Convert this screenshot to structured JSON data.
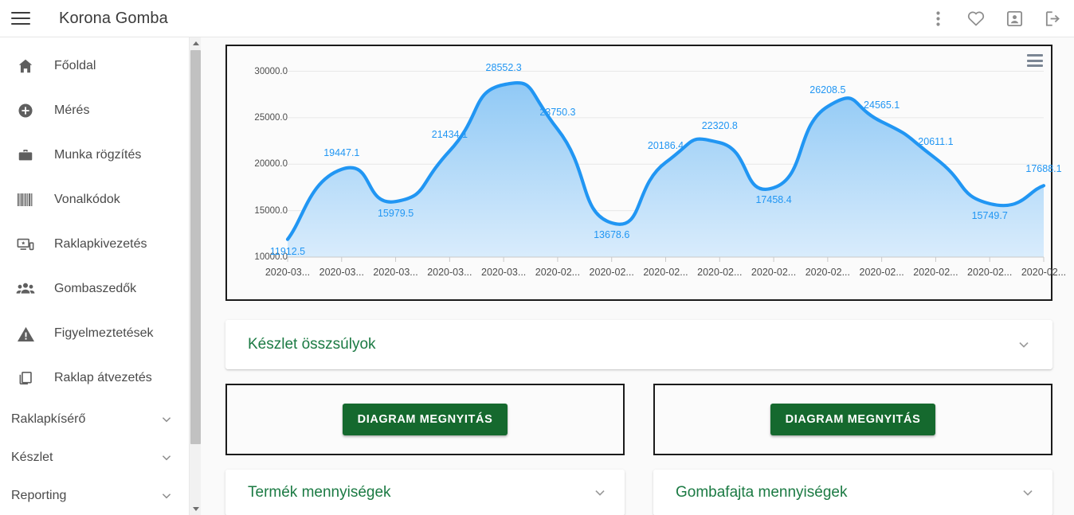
{
  "topbar": {
    "app_title": "Korona Gomba",
    "menu_icon": "hamburger-icon",
    "actions": [
      {
        "name": "more-vert-icon",
        "label": ""
      },
      {
        "name": "favorite-icon",
        "label": ""
      },
      {
        "name": "account-box-icon",
        "label": ""
      },
      {
        "name": "logout-icon",
        "label": ""
      }
    ]
  },
  "sidebar": {
    "items": [
      {
        "label": "Főoldal",
        "icon": "home-icon"
      },
      {
        "label": "Mérés",
        "icon": "add-circle-icon"
      },
      {
        "label": "Munka rögzítés",
        "icon": "briefcase-icon"
      },
      {
        "label": "Vonalkódok",
        "icon": "barcode-icon"
      },
      {
        "label": "Raklapkivezetés",
        "icon": "devices-icon"
      },
      {
        "label": "Gombaszedők",
        "icon": "people-icon"
      },
      {
        "label": "Figyelmeztetések",
        "icon": "warning-icon"
      },
      {
        "label": "Raklap átvezetés",
        "icon": "copy-icon"
      }
    ],
    "groups": [
      {
        "label": "Raklapkísérő",
        "icon": "chevron-down-icon"
      },
      {
        "label": "Készlet",
        "icon": "chevron-down-icon"
      },
      {
        "label": "Reporting",
        "icon": "chevron-down-icon"
      }
    ]
  },
  "main": {
    "panels": {
      "stock_weights": "Készlet összsúlyok",
      "product_quantities": "Termék mennyiségek",
      "mushroom_type_quantities": "Gombafajta mennyiségek"
    },
    "open_chart_button": "DIAGRAM MEGNYITÁS",
    "chart_menu_icon": "chart-context-menu-icon"
  },
  "chart_data": {
    "type": "area",
    "title": "",
    "xlabel": "",
    "ylabel": "",
    "ylim": [
      10000,
      31500
    ],
    "yticks": [
      "10000.0",
      "15000.0",
      "20000.0",
      "25000.0",
      "30000.0"
    ],
    "ytick_values": [
      10000,
      15000,
      20000,
      25000,
      30000
    ],
    "grid": true,
    "legend": "none",
    "line_color": "#2196f3",
    "fill_color": "#bcdffb",
    "label_color": "#2196f3",
    "categories": [
      "2020-03...",
      "2020-03...",
      "2020-03...",
      "2020-03...",
      "2020-03...",
      "2020-02...",
      "2020-02...",
      "2020-02...",
      "2020-02...",
      "2020-02...",
      "2020-02...",
      "2020-02...",
      "2020-02...",
      "2020-02...",
      "2020-02..."
    ],
    "values": [
      11912.5,
      19447.1,
      15979.5,
      21434.1,
      28552.3,
      23750.3,
      13678.6,
      20186.4,
      22320.8,
      17458.4,
      26208.5,
      24565.1,
      20611.1,
      15749.7,
      17688.1
    ],
    "data_labels": [
      "11912.5",
      "19447.1",
      "15979.5",
      "21434.1",
      "28552.3",
      "23750.3",
      "13678.6",
      "20186.4",
      "22320.8",
      "17458.4",
      "26208.5",
      "24565.1",
      "20611.1",
      "15749.7",
      "17688.1"
    ]
  },
  "colors": {
    "brand_green": "#15692e",
    "panel_title_green": "#1b7a43",
    "chart_blue": "#2196f3"
  }
}
